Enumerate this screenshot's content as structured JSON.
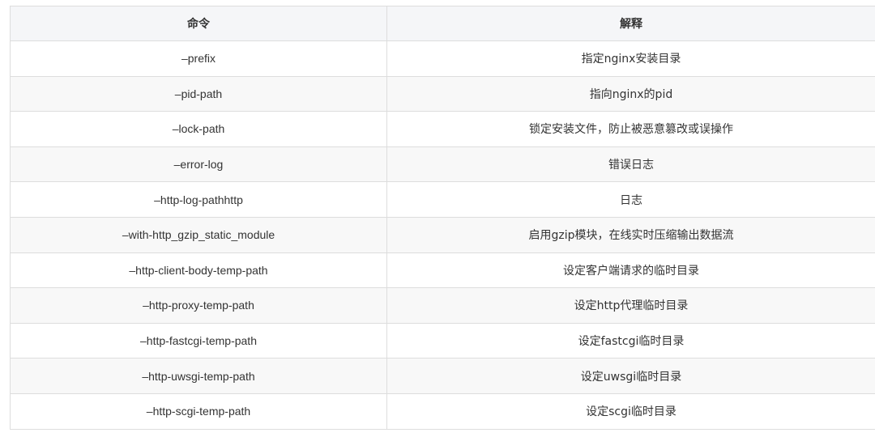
{
  "table": {
    "headers": [
      "命令",
      "解释"
    ],
    "rows": [
      {
        "command": "–prefix",
        "description": "指定nginx安装目录"
      },
      {
        "command": "–pid-path",
        "description": "指向nginx的pid"
      },
      {
        "command": "–lock-path",
        "description": "锁定安装文件，防止被恶意篡改或误操作"
      },
      {
        "command": "–error-log",
        "description": "错误日志"
      },
      {
        "command": "–http-log-pathhttp",
        "description": "日志"
      },
      {
        "command": "–with-http_gzip_static_module",
        "description": "启用gzip模块，在线实时压缩输出数据流"
      },
      {
        "command": "–http-client-body-temp-path",
        "description": "设定客户端请求的临时目录"
      },
      {
        "command": "–http-proxy-temp-path",
        "description": "设定http代理临时目录"
      },
      {
        "command": "–http-fastcgi-temp-path",
        "description": "设定fastcgi临时目录"
      },
      {
        "command": "–http-uwsgi-temp-path",
        "description": "设定uwsgi临时目录"
      },
      {
        "command": "–http-scgi-temp-path",
        "description": "设定scgi临时目录"
      }
    ]
  }
}
